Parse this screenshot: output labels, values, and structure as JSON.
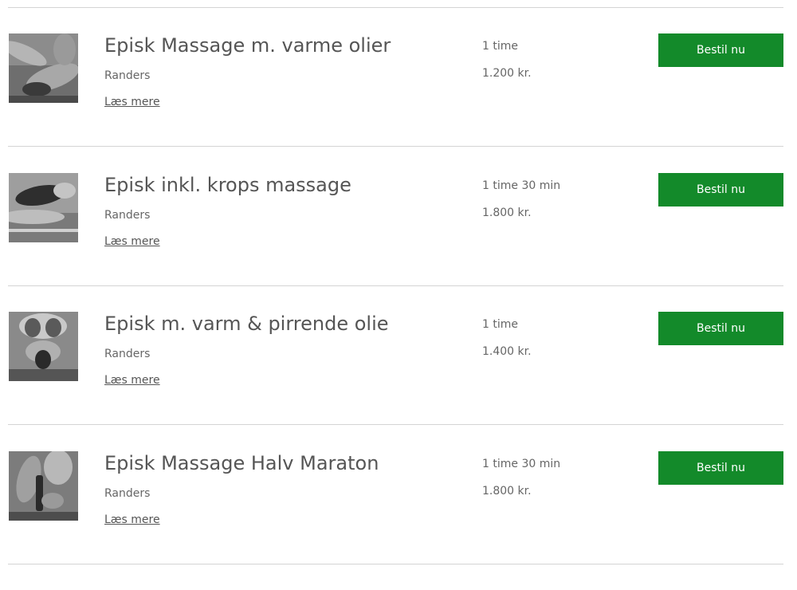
{
  "services": [
    {
      "title": "Episk Massage m. varme olier",
      "location": "Randers",
      "read_more": "Læs mere",
      "duration": "1 time",
      "price": "1.200 kr.",
      "book_label": "Bestil nu",
      "image": "massage-photo"
    },
    {
      "title": "Episk inkl. krops massage",
      "location": "Randers",
      "read_more": "Læs mere",
      "duration": "1 time 30 min",
      "price": "1.800 kr.",
      "book_label": "Bestil nu",
      "image": "massage-photo"
    },
    {
      "title": "Episk m. varm & pirrende olie",
      "location": "Randers",
      "read_more": "Læs mere",
      "duration": "1 time",
      "price": "1.400 kr.",
      "book_label": "Bestil nu",
      "image": "massage-photo"
    },
    {
      "title": "Episk Massage Halv Maraton",
      "location": "Randers",
      "read_more": "Læs mere",
      "duration": "1 time 30 min",
      "price": "1.800 kr.",
      "book_label": "Bestil nu",
      "image": "massage-photo"
    }
  ],
  "colors": {
    "button": "#138a2a",
    "button_text": "#ffffff",
    "text": "#555555",
    "divider": "#d4d4d4"
  }
}
